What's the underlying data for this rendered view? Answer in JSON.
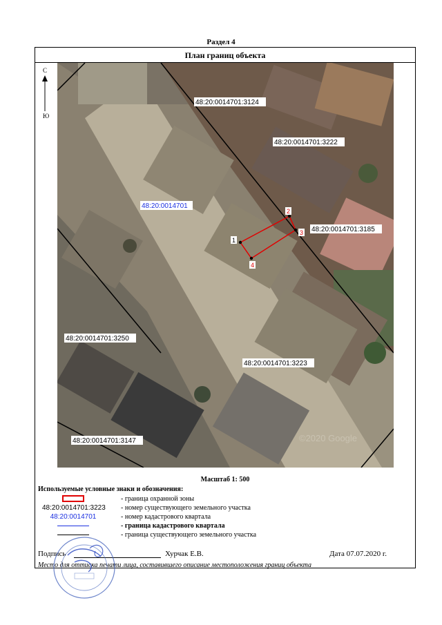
{
  "section": {
    "title": "Раздел 4"
  },
  "header": {
    "title": "План границ объекта"
  },
  "compass": {
    "north": "С",
    "south": "Ю"
  },
  "map": {
    "colors": {
      "parcel_boundary": "#e00000",
      "quarter_text": "#1a2fe0"
    },
    "quarter_label": "48:20:0014701",
    "parcel_labels": [
      "48:20:0014701:3124",
      "48:20:0014701:3222",
      "48:20:0014701:3185",
      "48:20:0014701:3250",
      "48:20:0014701:3223",
      "48:20:0014701:3147"
    ],
    "points": [
      "1",
      "2",
      "3",
      "4"
    ],
    "watermark": "©2020 Google"
  },
  "scale": {
    "label": "Масштаб 1: 500"
  },
  "legend": {
    "title": "Используемые условные знаки и обозначения:",
    "items": [
      {
        "symbol_text": "",
        "desc": "- граница  охранной зоны"
      },
      {
        "symbol_text": "48:20:0014701:3223",
        "desc": "- номер существующего земельного участка"
      },
      {
        "symbol_text": "48:20:0014701",
        "desc": "- номер кадастрового квартала"
      },
      {
        "symbol_text": "",
        "desc": "- граница кадастрового квартала"
      },
      {
        "symbol_text": "",
        "desc": "- граница существующего земельного участка"
      }
    ]
  },
  "signature": {
    "label": "Подпись",
    "name": "Хурчак Е.В.",
    "date": "Дата 07.07.2020 г.",
    "note": "Место для оттиска печати лица, составившего описание местоположения границ объекта"
  }
}
